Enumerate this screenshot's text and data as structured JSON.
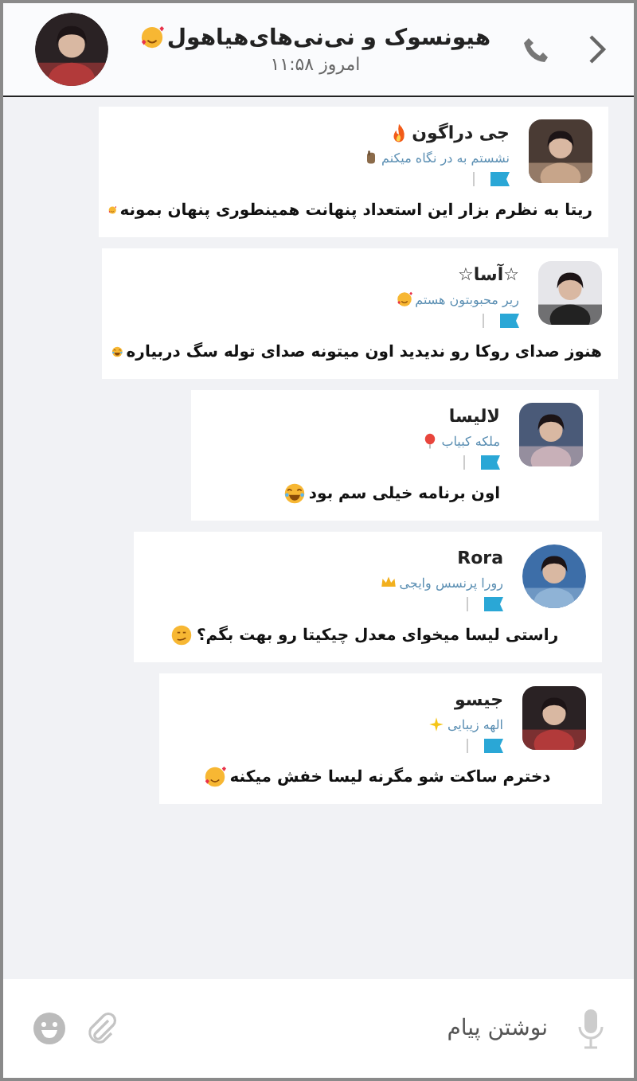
{
  "header": {
    "title": "هیونسوک و نی‌نی‌های‌هیاهول",
    "title_emoji": {
      "kind": "love"
    },
    "subtitle": "امروز ۱۱:۵۸"
  },
  "messages": [
    {
      "name": "جی دراگون",
      "name_emoji": {
        "kind": "fire"
      },
      "status": "نشستم به در نگاه میکنم",
      "status_emoji": {
        "kind": "hand"
      },
      "text": "ریتا به نظرم بزار این استعداد پنهانت همینطوری پنهان بمونه",
      "text_emoji": {
        "kind": "love"
      },
      "avatar": {
        "kind": "rounded"
      }
    },
    {
      "name": "☆آسا☆",
      "status": "ریر محبوبتون هستم",
      "status_emoji": {
        "kind": "love"
      },
      "text": "هنوز صدای روکا رو ندیدید اون میتونه صدای توله سگ دربیاره",
      "text_emoji": {
        "kind": "laugh"
      },
      "avatar": {
        "kind": "rounded"
      }
    },
    {
      "name": "لالیسا",
      "status": "ملکه کبیاب",
      "status_emoji": {
        "kind": "balloon"
      },
      "text": "اون برنامه خیلی سم بود",
      "text_emoji": {
        "kind": "laugh"
      },
      "avatar": {
        "kind": "rounded"
      }
    },
    {
      "name": "Rora",
      "status": "رورا پرنسس وایجی",
      "status_emoji": {
        "kind": "crown"
      },
      "text": "راستی لیسا میخوای معدل چیکیتا رو بهت بگم؟",
      "text_emoji": {
        "kind": "smirk"
      },
      "avatar": {
        "kind": "circle"
      }
    },
    {
      "name": "جیسو",
      "status": "الهه زیبایی",
      "status_emoji": {
        "kind": "sparkle"
      },
      "text": "دخترم ساکت شو مگرنه لیسا خفش میکنه",
      "text_emoji": {
        "kind": "love"
      },
      "avatar": {
        "kind": "rounded"
      }
    }
  ],
  "composer": {
    "placeholder": "نوشتن پیام"
  }
}
